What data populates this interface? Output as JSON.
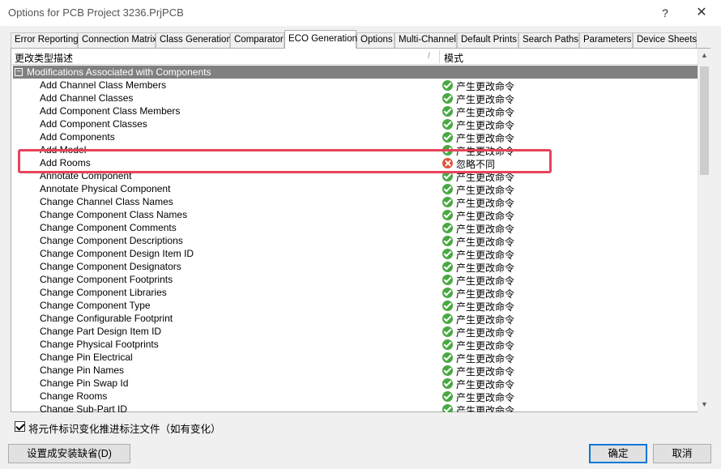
{
  "window": {
    "title": "Options for PCB Project 3236.PrjPCB",
    "help_glyph": "?",
    "close_glyph": "✕"
  },
  "tabs": [
    {
      "label": "Error Reporting"
    },
    {
      "label": "Connection Matrix"
    },
    {
      "label": "Class Generation"
    },
    {
      "label": "Comparator"
    },
    {
      "label": "ECO Generation",
      "active": true
    },
    {
      "label": "Options"
    },
    {
      "label": "Multi-Channel"
    },
    {
      "label": "Default Prints"
    },
    {
      "label": "Search Paths"
    },
    {
      "label": "Parameters"
    },
    {
      "label": "Device Sheets"
    }
  ],
  "table": {
    "col_description": "更改类型描述",
    "sort_glyph": "/",
    "col_mode": "模式",
    "group_expander": "−",
    "group_label": "Modifications Associated with Components",
    "rows": [
      {
        "name": "Add Channel Class Members",
        "mode": "产生更改命令",
        "icon": "check-icon"
      },
      {
        "name": "Add Channel Classes",
        "mode": "产生更改命令",
        "icon": "check-icon"
      },
      {
        "name": "Add Component Class Members",
        "mode": "产生更改命令",
        "icon": "check-icon"
      },
      {
        "name": "Add Component Classes",
        "mode": "产生更改命令",
        "icon": "check-icon"
      },
      {
        "name": "Add Components",
        "mode": "产生更改命令",
        "icon": "check-icon"
      },
      {
        "name": "Add Model",
        "mode": "产生更改命令",
        "icon": "check-icon"
      },
      {
        "name": "Add Rooms",
        "mode": "忽略不同",
        "icon": "ignore-icon"
      },
      {
        "name": "Annotate Component",
        "mode": "产生更改命令",
        "icon": "check-icon"
      },
      {
        "name": "Annotate Physical Component",
        "mode": "产生更改命令",
        "icon": "check-icon"
      },
      {
        "name": "Change Channel Class Names",
        "mode": "产生更改命令",
        "icon": "check-icon"
      },
      {
        "name": "Change Component Class Names",
        "mode": "产生更改命令",
        "icon": "check-icon"
      },
      {
        "name": "Change Component Comments",
        "mode": "产生更改命令",
        "icon": "check-icon"
      },
      {
        "name": "Change Component Descriptions",
        "mode": "产生更改命令",
        "icon": "check-icon"
      },
      {
        "name": "Change Component Design Item ID",
        "mode": "产生更改命令",
        "icon": "check-icon"
      },
      {
        "name": "Change Component Designators",
        "mode": "产生更改命令",
        "icon": "check-icon"
      },
      {
        "name": "Change Component Footprints",
        "mode": "产生更改命令",
        "icon": "check-icon"
      },
      {
        "name": "Change Component Libraries",
        "mode": "产生更改命令",
        "icon": "check-icon"
      },
      {
        "name": "Change Component Type",
        "mode": "产生更改命令",
        "icon": "check-icon"
      },
      {
        "name": "Change Configurable Footprint",
        "mode": "产生更改命令",
        "icon": "check-icon"
      },
      {
        "name": "Change Part Design Item ID",
        "mode": "产生更改命令",
        "icon": "check-icon"
      },
      {
        "name": "Change Physical Footprints",
        "mode": "产生更改命令",
        "icon": "check-icon"
      },
      {
        "name": "Change Pin Electrical",
        "mode": "产生更改命令",
        "icon": "check-icon"
      },
      {
        "name": "Change Pin Names",
        "mode": "产生更改命令",
        "icon": "check-icon"
      },
      {
        "name": "Change Pin Swap Id",
        "mode": "产生更改命令",
        "icon": "check-icon"
      },
      {
        "name": "Change Rooms",
        "mode": "产生更改命令",
        "icon": "check-icon"
      },
      {
        "name": "Change Sub-Part ID",
        "mode": "产生更改命令",
        "icon": "check-icon"
      }
    ]
  },
  "checkbox": {
    "label": "将元件标识变化推进标注文件（如有变化）",
    "checked": true
  },
  "buttons": {
    "default_settings": "设置成安装缺省(D)",
    "ok": "确定",
    "cancel": "取消"
  },
  "colors": {
    "group_row_bg": "#808080",
    "highlight_border": "#e8435a",
    "ok_icon": "#4aa842",
    "ignore_icon": "#e0523a",
    "focus_border": "#0078d7"
  }
}
